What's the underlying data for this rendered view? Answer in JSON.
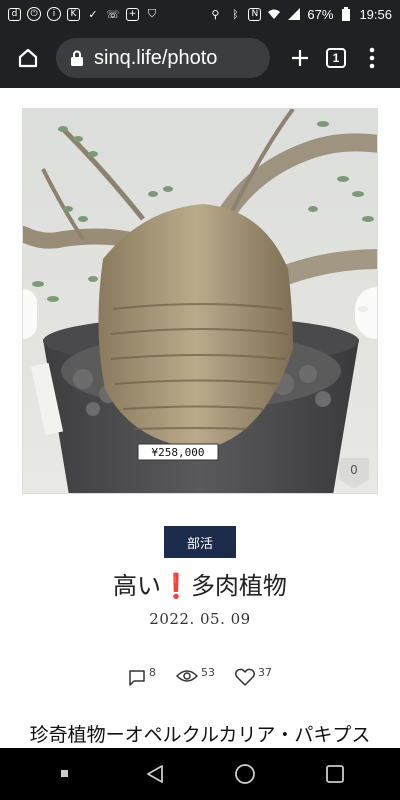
{
  "status_bar": {
    "battery": "67%",
    "time": "19:56"
  },
  "browser": {
    "url": "sinq.life/photo",
    "tab_count": "1"
  },
  "post": {
    "image_like_count": "0",
    "category": "部活",
    "title_before": "高い",
    "title_mark": "❗",
    "title_after": "多肉植物",
    "date": "2022. 05. 09",
    "comments": "8",
    "views": "53",
    "likes": "37",
    "subtitle": "珍奇植物ーオペルクルカリア・パキプス"
  },
  "price_tag": "¥258,000",
  "colors": {
    "category_bg": "#1c2b4a",
    "accent_red": "#e2231a",
    "chrome_bg": "#202124"
  }
}
